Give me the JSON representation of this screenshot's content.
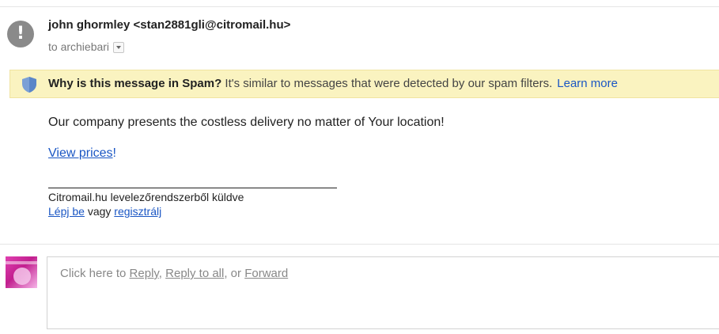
{
  "header": {
    "avatar_glyph": "!",
    "sender": "john ghormley <stan2881gli@citromail.hu>",
    "to_label": "to archiebari"
  },
  "spam_bar": {
    "icon": "shield-icon",
    "bold_text": "Why is this message in Spam?",
    "text": " It's similar to messages that were detected by our spam filters.",
    "link": "Learn more",
    "background": "#faf3c0"
  },
  "message": {
    "line1": "Our company presents the costless delivery no matter of Your location!",
    "link": "View prices",
    "link_suffix": "!",
    "signature": {
      "line1": "Citromail.hu levelezőrendszerből küldve",
      "login_link": "Lépj be",
      "middle": " vagy ",
      "register_link": "regisztrálj"
    }
  },
  "reply": {
    "prefix": "Click here to ",
    "reply_link": "Reply",
    "sep1": ", ",
    "reply_all_link": "Reply to all",
    "sep2": ", or ",
    "forward_link": "Forward"
  },
  "colors": {
    "link": "#1a56c4",
    "warning_bg": "#faf3c0",
    "avatar_grey": "#8a8a8a"
  }
}
